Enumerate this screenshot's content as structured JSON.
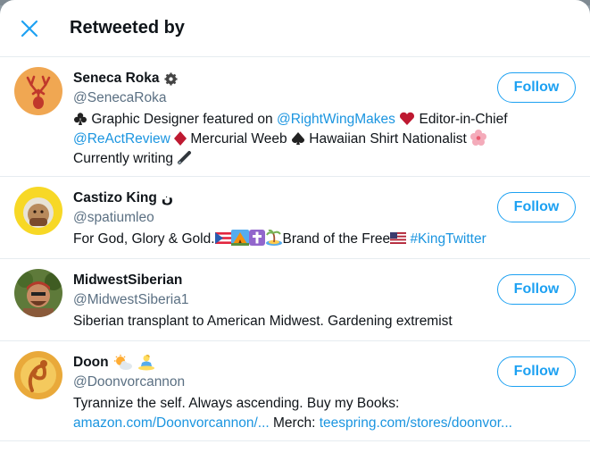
{
  "header": {
    "title": "Retweeted by"
  },
  "users": [
    {
      "name": "Seneca Roka",
      "handle": "@SenecaRoka",
      "follow_label": "Follow",
      "bio": {
        "t1": "Graphic Designer featured on ",
        "l1": "@RightWingMakes",
        "t2": " Editor-in-Chief ",
        "l2": "@ReActReview",
        "t3": " Mercurial Weeb ",
        "t4": " Hawaiian Shirt Nationalist ",
        "t5": "Currently writing "
      }
    },
    {
      "name": "Castizo King",
      "name_suffix": "ن",
      "handle": "@spatiumleo",
      "follow_label": "Follow",
      "bio": {
        "t1": "For God, Glory & Gold.",
        "t2": "Brand of the Free",
        "l1": "#KingTwitter"
      }
    },
    {
      "name": "MidwestSiberian",
      "handle": "@MidwestSiberia1",
      "follow_label": "Follow",
      "bio": {
        "t1": "Siberian transplant to American Midwest. Gardening extremist"
      }
    },
    {
      "name": "Doon",
      "handle": "@Doonvorcannon",
      "follow_label": "Follow",
      "bio": {
        "t1": "Tyrannize the self. Always ascending. Buy my Books:",
        "l1": "amazon.com/Doonvorcannon/...",
        "t2": " Merch: ",
        "l2": "teespring.com/stores/doonvor..."
      }
    }
  ],
  "colors": {
    "accent": "#1da1f2",
    "link": "#1b95e0",
    "secondary_text": "#5b7083"
  }
}
